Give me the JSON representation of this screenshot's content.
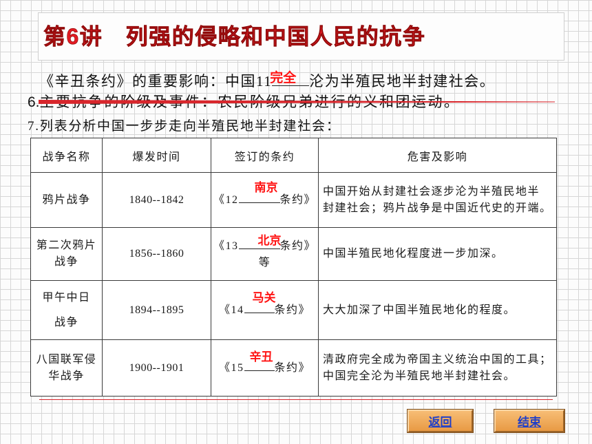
{
  "title": "第6讲　列强的侵略和中国人民的抗争",
  "content": {
    "line1": {
      "prefix": "《辛丑条约》的重要影响：中国11",
      "answer": "完全",
      "suffix": "沦为半殖民地半封建社会。"
    },
    "line2": {
      "number": "6.",
      "text": "主要抗争的阶级及事件：农民阶级兄弟进行的义和团运动。"
    },
    "line3": "7.列表分析中国一步步走向半殖民地半封建社会："
  },
  "table": {
    "headers": [
      "战争名称",
      "爆发时间",
      "签订的条约",
      "危害及影响"
    ],
    "rows": [
      {
        "name": [
          "鸦片战争"
        ],
        "period": "1840--1842",
        "treaty_prefix": "《12",
        "answer": "南京",
        "treaty_suffix": "条约》",
        "impact": [
          "中国开始从封建社会逐步沦为半殖民地半",
          "封建社会；鸦片战争是中国近代史的开端。"
        ]
      },
      {
        "name": [
          "第二次鸦片",
          "战争"
        ],
        "period": "1856--1860",
        "treaty_prefix": "《13",
        "answer": "北京",
        "treaty_suffix": "条约》",
        "treaty_extra": "等",
        "impact": [
          "中国半殖民地化程度进一步加深。"
        ]
      },
      {
        "name": [
          "甲午中日",
          "战争"
        ],
        "period": "1894--1895",
        "treaty_prefix": "《14",
        "answer": "马关",
        "treaty_suffix": "条约》",
        "impact": [
          "大大加深了中国半殖民地化的程度。"
        ]
      },
      {
        "name": [
          "八国联军侵",
          "华战争"
        ],
        "period": "1900--1901",
        "treaty_prefix": "《15",
        "answer": "辛丑",
        "treaty_suffix": "条约》",
        "impact": [
          "清政府完全成为帝国主义统治中国的工具；",
          "中国完全沦为半殖民地半封建社会。"
        ]
      }
    ]
  },
  "buttons": {
    "back": "返回",
    "end": "结束"
  },
  "colors": {
    "title": "#e31b23",
    "answer": "#ff1414",
    "accent_line": "#d8262c",
    "button_text": "#2140c8",
    "button_fill": "#e89a44"
  }
}
